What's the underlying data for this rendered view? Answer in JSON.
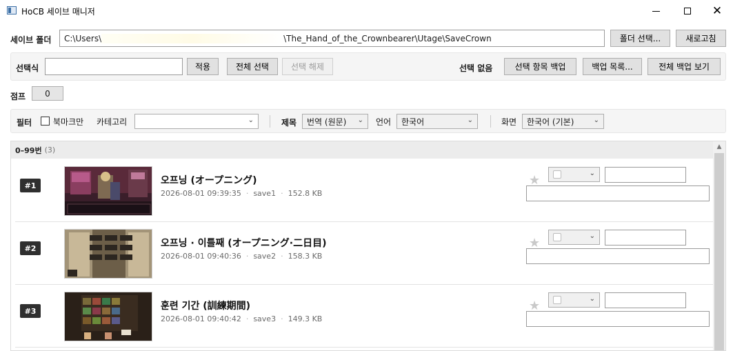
{
  "window": {
    "title": "HoCB 세이브 매니저",
    "controls": {
      "minimize": "—",
      "maximize": "☐",
      "close": "✕"
    }
  },
  "folder": {
    "label": "세이브 폴더",
    "path_prefix": "C:\\Users\\",
    "path_suffix": "\\The_Hand_of_the_Crownbearer\\Utage\\SaveCrown",
    "select_button": "폴더 선택...",
    "refresh_button": "새로고침"
  },
  "selection": {
    "label": "선택식",
    "input_value": "",
    "apply_button": "적용",
    "select_all_button": "전체 선택",
    "deselect_button": "선택 해제",
    "status": "선택 없음",
    "backup_selected_button": "선택 항목 백업",
    "backup_list_button": "백업 목록...",
    "view_all_backups_button": "전체 백업 보기"
  },
  "jump": {
    "label": "점프",
    "value": "0"
  },
  "filter": {
    "label": "필터",
    "bookmark_only_label": "북마크만",
    "bookmark_only_checked": false,
    "category_label": "카테고리",
    "category_value": "",
    "title_label": "제목",
    "title_value": "번역 (원문)",
    "language_label": "언어",
    "language_value": "한국어",
    "screen_label": "화면",
    "screen_value": "한국어 (기본)"
  },
  "list": {
    "group": {
      "range": "0–99번",
      "count": "(3)"
    },
    "rows": [
      {
        "badge": "#1",
        "title": "오프닝 (オープニング)",
        "datetime": "2026-08-01 09:39:35",
        "slot": "save1",
        "size": "152.8 KB"
      },
      {
        "badge": "#2",
        "title": "오프닝 · 이틀째 (オープニング·二日目)",
        "datetime": "2026-08-01 09:40:36",
        "slot": "save2",
        "size": "158.3 KB"
      },
      {
        "badge": "#3",
        "title": "훈련 기간 (訓練期間)",
        "datetime": "2026-08-01 09:40:42",
        "slot": "save3",
        "size": "149.3 KB"
      }
    ]
  },
  "icons": {
    "star": "star-icon",
    "dropdown": "chevron-down-icon",
    "scroll_up": "chevron-up-icon"
  },
  "colors": {
    "badge_bg": "#2f2f2f",
    "panel_bg": "#f5f5f5",
    "button_bg": "#e1e1e1",
    "star": "#c9c9c9"
  }
}
